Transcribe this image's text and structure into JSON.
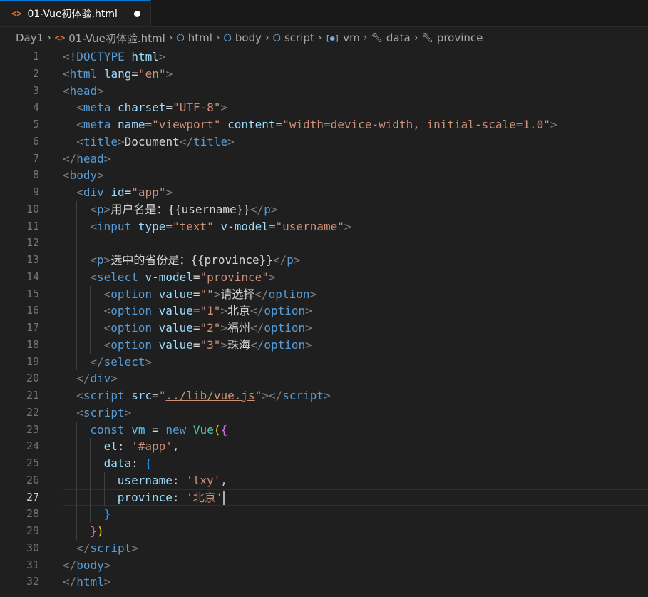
{
  "tab": {
    "title": "01-Vue初体验.html"
  },
  "breadcrumb": [
    "Day1",
    "01-Vue初体验.html",
    "html",
    "body",
    "script",
    "vm",
    "data",
    "province"
  ],
  "lines": [
    {
      "n": "1",
      "indent": 0,
      "tokens": [
        [
          "t-punc",
          "<"
        ],
        [
          "t-kw",
          "!DOCTYPE"
        ],
        [
          "t-text",
          " "
        ],
        [
          "t-attr",
          "html"
        ],
        [
          "t-punc",
          ">"
        ]
      ]
    },
    {
      "n": "2",
      "indent": 0,
      "tokens": [
        [
          "t-punc",
          "<"
        ],
        [
          "t-tag",
          "html"
        ],
        [
          "t-text",
          " "
        ],
        [
          "t-attr",
          "lang"
        ],
        [
          "t-text",
          "="
        ],
        [
          "t-str",
          "\"en\""
        ],
        [
          "t-punc",
          ">"
        ]
      ]
    },
    {
      "n": "3",
      "indent": 0,
      "tokens": [
        [
          "t-punc",
          "<"
        ],
        [
          "t-tag",
          "head"
        ],
        [
          "t-punc",
          ">"
        ]
      ]
    },
    {
      "n": "4",
      "indent": 1,
      "tokens": [
        [
          "t-punc",
          "<"
        ],
        [
          "t-tag",
          "meta"
        ],
        [
          "t-text",
          " "
        ],
        [
          "t-attr",
          "charset"
        ],
        [
          "t-text",
          "="
        ],
        [
          "t-str",
          "\"UTF-8\""
        ],
        [
          "t-punc",
          ">"
        ]
      ]
    },
    {
      "n": "5",
      "indent": 1,
      "tokens": [
        [
          "t-punc",
          "<"
        ],
        [
          "t-tag",
          "meta"
        ],
        [
          "t-text",
          " "
        ],
        [
          "t-attr",
          "name"
        ],
        [
          "t-text",
          "="
        ],
        [
          "t-str",
          "\"viewport\""
        ],
        [
          "t-text",
          " "
        ],
        [
          "t-attr",
          "content"
        ],
        [
          "t-text",
          "="
        ],
        [
          "t-str",
          "\"width=device-width, initial-scale=1.0\""
        ],
        [
          "t-punc",
          ">"
        ]
      ]
    },
    {
      "n": "6",
      "indent": 1,
      "tokens": [
        [
          "t-punc",
          "<"
        ],
        [
          "t-tag",
          "title"
        ],
        [
          "t-punc",
          ">"
        ],
        [
          "t-text",
          "Document"
        ],
        [
          "t-punc",
          "</"
        ],
        [
          "t-tag",
          "title"
        ],
        [
          "t-punc",
          ">"
        ]
      ]
    },
    {
      "n": "7",
      "indent": 0,
      "tokens": [
        [
          "t-punc",
          "</"
        ],
        [
          "t-tag",
          "head"
        ],
        [
          "t-punc",
          ">"
        ]
      ]
    },
    {
      "n": "8",
      "indent": 0,
      "tokens": [
        [
          "t-punc",
          "<"
        ],
        [
          "t-tag",
          "body"
        ],
        [
          "t-punc",
          ">"
        ]
      ]
    },
    {
      "n": "9",
      "indent": 1,
      "tokens": [
        [
          "t-punc",
          "<"
        ],
        [
          "t-tag",
          "div"
        ],
        [
          "t-text",
          " "
        ],
        [
          "t-attr",
          "id"
        ],
        [
          "t-text",
          "="
        ],
        [
          "t-str",
          "\"app\""
        ],
        [
          "t-punc",
          ">"
        ]
      ]
    },
    {
      "n": "10",
      "indent": 2,
      "tokens": [
        [
          "t-punc",
          "<"
        ],
        [
          "t-tag",
          "p"
        ],
        [
          "t-punc",
          ">"
        ],
        [
          "t-text",
          "用户名是：{{username}}"
        ],
        [
          "t-punc",
          "</"
        ],
        [
          "t-tag",
          "p"
        ],
        [
          "t-punc",
          ">"
        ]
      ]
    },
    {
      "n": "11",
      "indent": 2,
      "tokens": [
        [
          "t-punc",
          "<"
        ],
        [
          "t-tag",
          "input"
        ],
        [
          "t-text",
          " "
        ],
        [
          "t-attr",
          "type"
        ],
        [
          "t-text",
          "="
        ],
        [
          "t-str",
          "\"text\""
        ],
        [
          "t-text",
          " "
        ],
        [
          "t-attr",
          "v-model"
        ],
        [
          "t-text",
          "="
        ],
        [
          "t-str",
          "\"username\""
        ],
        [
          "t-punc",
          ">"
        ]
      ]
    },
    {
      "n": "12",
      "indent": 2,
      "tokens": []
    },
    {
      "n": "13",
      "indent": 2,
      "tokens": [
        [
          "t-punc",
          "<"
        ],
        [
          "t-tag",
          "p"
        ],
        [
          "t-punc",
          ">"
        ],
        [
          "t-text",
          "选中的省份是：{{province}}"
        ],
        [
          "t-punc",
          "</"
        ],
        [
          "t-tag",
          "p"
        ],
        [
          "t-punc",
          ">"
        ]
      ]
    },
    {
      "n": "14",
      "indent": 2,
      "tokens": [
        [
          "t-punc",
          "<"
        ],
        [
          "t-tag",
          "select"
        ],
        [
          "t-text",
          " "
        ],
        [
          "t-attr",
          "v-model"
        ],
        [
          "t-text",
          "="
        ],
        [
          "t-str",
          "\"province\""
        ],
        [
          "t-punc",
          ">"
        ]
      ]
    },
    {
      "n": "15",
      "indent": 3,
      "tokens": [
        [
          "t-punc",
          "<"
        ],
        [
          "t-tag",
          "option"
        ],
        [
          "t-text",
          " "
        ],
        [
          "t-attr",
          "value"
        ],
        [
          "t-text",
          "="
        ],
        [
          "t-str",
          "\"\""
        ],
        [
          "t-punc",
          ">"
        ],
        [
          "t-text",
          "请选择"
        ],
        [
          "t-punc",
          "</"
        ],
        [
          "t-tag",
          "option"
        ],
        [
          "t-punc",
          ">"
        ]
      ]
    },
    {
      "n": "16",
      "indent": 3,
      "tokens": [
        [
          "t-punc",
          "<"
        ],
        [
          "t-tag",
          "option"
        ],
        [
          "t-text",
          " "
        ],
        [
          "t-attr",
          "value"
        ],
        [
          "t-text",
          "="
        ],
        [
          "t-str",
          "\"1\""
        ],
        [
          "t-punc",
          ">"
        ],
        [
          "t-text",
          "北京"
        ],
        [
          "t-punc",
          "</"
        ],
        [
          "t-tag",
          "option"
        ],
        [
          "t-punc",
          ">"
        ]
      ]
    },
    {
      "n": "17",
      "indent": 3,
      "tokens": [
        [
          "t-punc",
          "<"
        ],
        [
          "t-tag",
          "option"
        ],
        [
          "t-text",
          " "
        ],
        [
          "t-attr",
          "value"
        ],
        [
          "t-text",
          "="
        ],
        [
          "t-str",
          "\"2\""
        ],
        [
          "t-punc",
          ">"
        ],
        [
          "t-text",
          "福州"
        ],
        [
          "t-punc",
          "</"
        ],
        [
          "t-tag",
          "option"
        ],
        [
          "t-punc",
          ">"
        ]
      ]
    },
    {
      "n": "18",
      "indent": 3,
      "tokens": [
        [
          "t-punc",
          "<"
        ],
        [
          "t-tag",
          "option"
        ],
        [
          "t-text",
          " "
        ],
        [
          "t-attr",
          "value"
        ],
        [
          "t-text",
          "="
        ],
        [
          "t-str",
          "\"3\""
        ],
        [
          "t-punc",
          ">"
        ],
        [
          "t-text",
          "珠海"
        ],
        [
          "t-punc",
          "</"
        ],
        [
          "t-tag",
          "option"
        ],
        [
          "t-punc",
          ">"
        ]
      ]
    },
    {
      "n": "19",
      "indent": 2,
      "tokens": [
        [
          "t-punc",
          "</"
        ],
        [
          "t-tag",
          "select"
        ],
        [
          "t-punc",
          ">"
        ]
      ]
    },
    {
      "n": "20",
      "indent": 1,
      "tokens": [
        [
          "t-punc",
          "</"
        ],
        [
          "t-tag",
          "div"
        ],
        [
          "t-punc",
          ">"
        ]
      ]
    },
    {
      "n": "21",
      "indent": 1,
      "tokens": [
        [
          "t-punc",
          "<"
        ],
        [
          "t-tag",
          "script"
        ],
        [
          "t-text",
          " "
        ],
        [
          "t-attr",
          "src"
        ],
        [
          "t-text",
          "="
        ],
        [
          "t-str",
          "\""
        ],
        [
          "t-link",
          "../lib/vue.js"
        ],
        [
          "t-str",
          "\""
        ],
        [
          "t-punc",
          "></"
        ],
        [
          "t-tag",
          "script"
        ],
        [
          "t-punc",
          ">"
        ]
      ]
    },
    {
      "n": "22",
      "indent": 1,
      "tokens": [
        [
          "t-punc",
          "<"
        ],
        [
          "t-tag",
          "script"
        ],
        [
          "t-punc",
          ">"
        ]
      ]
    },
    {
      "n": "23",
      "indent": 2,
      "tokens": [
        [
          "t-kw",
          "const"
        ],
        [
          "t-text",
          " "
        ],
        [
          "t-var",
          "vm"
        ],
        [
          "t-text",
          " = "
        ],
        [
          "t-kw",
          "new"
        ],
        [
          "t-text",
          " "
        ],
        [
          "t-fn",
          "Vue"
        ],
        [
          "t-b1",
          "("
        ],
        [
          "t-b2",
          "{"
        ]
      ]
    },
    {
      "n": "24",
      "indent": 3,
      "tokens": [
        [
          "t-prop",
          "el"
        ],
        [
          "t-text",
          ": "
        ],
        [
          "t-str",
          "'#app'"
        ],
        [
          "t-text",
          ","
        ]
      ]
    },
    {
      "n": "25",
      "indent": 3,
      "tokens": [
        [
          "t-prop",
          "data"
        ],
        [
          "t-text",
          ": "
        ],
        [
          "t-b3",
          "{"
        ]
      ]
    },
    {
      "n": "26",
      "indent": 4,
      "tokens": [
        [
          "t-prop",
          "username"
        ],
        [
          "t-text",
          ": "
        ],
        [
          "t-str",
          "'lxy'"
        ],
        [
          "t-text",
          ","
        ]
      ]
    },
    {
      "n": "27",
      "indent": 4,
      "tokens": [
        [
          "t-prop",
          "province"
        ],
        [
          "t-text",
          ": "
        ],
        [
          "t-str",
          "'北京'"
        ]
      ],
      "current": true
    },
    {
      "n": "28",
      "indent": 3,
      "tokens": [
        [
          "t-b3",
          "}"
        ]
      ]
    },
    {
      "n": "29",
      "indent": 2,
      "tokens": [
        [
          "t-b2",
          "}"
        ],
        [
          "t-b1",
          ")"
        ]
      ]
    },
    {
      "n": "30",
      "indent": 1,
      "tokens": [
        [
          "t-punc",
          "</"
        ],
        [
          "t-tag",
          "script"
        ],
        [
          "t-punc",
          ">"
        ]
      ]
    },
    {
      "n": "31",
      "indent": 0,
      "tokens": [
        [
          "t-punc",
          "</"
        ],
        [
          "t-tag",
          "body"
        ],
        [
          "t-punc",
          ">"
        ]
      ]
    },
    {
      "n": "32",
      "indent": 0,
      "tokens": [
        [
          "t-punc",
          "</"
        ],
        [
          "t-tag",
          "html"
        ],
        [
          "t-punc",
          ">"
        ]
      ]
    }
  ]
}
